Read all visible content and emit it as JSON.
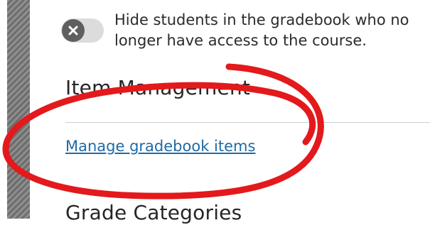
{
  "settings": {
    "hide_students": {
      "text": "Hide students in the gradebook who no longer have access to the course.",
      "toggle_state": "off",
      "toggle_icon": "close-icon"
    }
  },
  "item_management": {
    "heading": "Item Management",
    "link_label": "Manage gradebook items"
  },
  "grade_categories": {
    "heading": "Grade Categories"
  },
  "colors": {
    "link": "#1f6aa5",
    "annotation": "#e3191c",
    "toggle_knob": "#5f5f5f",
    "toggle_track": "#dcdcdc"
  },
  "annotation": {
    "type": "hand-drawn-circle",
    "target": "manage-gradebook-items-link"
  }
}
